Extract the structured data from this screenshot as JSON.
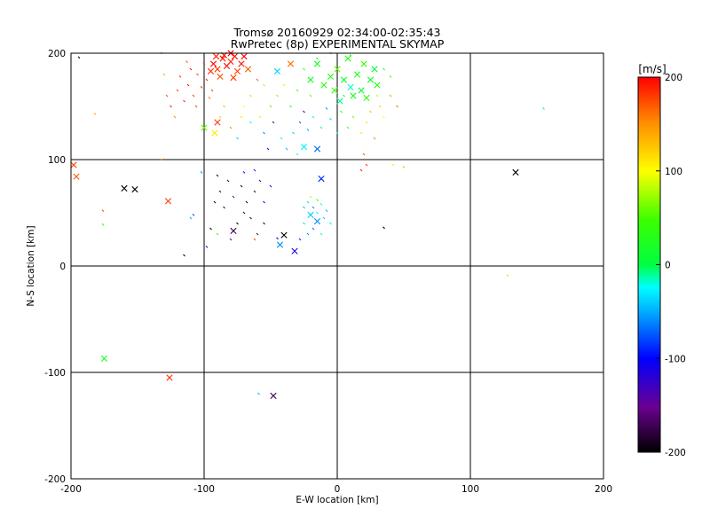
{
  "chart_data": {
    "type": "scatter",
    "title": "Tromsø 20160929 02:34:00-02:35:43",
    "subtitle": "RwPretec (8p) EXPERIMENTAL SKYMAP",
    "xlabel": "E-W location [km]",
    "ylabel": "N-S location [km]",
    "xlim": [
      -200,
      200
    ],
    "ylim": [
      -200,
      200
    ],
    "xticks": [
      "-200",
      "-100",
      "0",
      "100",
      "200"
    ],
    "yticks": [
      "-200",
      "-100",
      "0",
      "100",
      "200"
    ],
    "grid": true,
    "colorbar": {
      "label": "[m/s]",
      "range": [
        -200,
        200
      ],
      "ticks": [
        "-200",
        "-100",
        "0",
        "100",
        "200"
      ]
    },
    "cross_points": [
      {
        "x": -93,
        "y": 190,
        "v": 195
      },
      {
        "x": -90,
        "y": 185,
        "v": 180
      },
      {
        "x": -86,
        "y": 195,
        "v": 190
      },
      {
        "x": -83,
        "y": 188,
        "v": 200
      },
      {
        "x": -80,
        "y": 192,
        "v": 185
      },
      {
        "x": -77,
        "y": 197,
        "v": 195
      },
      {
        "x": -75,
        "y": 183,
        "v": 175
      },
      {
        "x": -72,
        "y": 190,
        "v": 190
      },
      {
        "x": -70,
        "y": 197,
        "v": 200
      },
      {
        "x": -88,
        "y": 178,
        "v": 170
      },
      {
        "x": -95,
        "y": 183,
        "v": 185
      },
      {
        "x": -85,
        "y": 198,
        "v": 195
      },
      {
        "x": -67,
        "y": 185,
        "v": 165
      },
      {
        "x": -78,
        "y": 177,
        "v": 180
      },
      {
        "x": -91,
        "y": 197,
        "v": 190
      },
      {
        "x": -80,
        "y": 200,
        "v": 200
      },
      {
        "x": -35,
        "y": 190,
        "v": 160
      },
      {
        "x": -15,
        "y": 190,
        "v": 20
      },
      {
        "x": -45,
        "y": 183,
        "v": -40
      },
      {
        "x": -10,
        "y": 170,
        "v": 40
      },
      {
        "x": -5,
        "y": 178,
        "v": 30
      },
      {
        "x": 0,
        "y": 185,
        "v": 60
      },
      {
        "x": 5,
        "y": 175,
        "v": 10
      },
      {
        "x": 10,
        "y": 168,
        "v": -20
      },
      {
        "x": 15,
        "y": 180,
        "v": 25
      },
      {
        "x": 20,
        "y": 190,
        "v": 45
      },
      {
        "x": 25,
        "y": 175,
        "v": 15
      },
      {
        "x": 30,
        "y": 170,
        "v": 30
      },
      {
        "x": 12,
        "y": 160,
        "v": 20
      },
      {
        "x": -2,
        "y": 165,
        "v": 50
      },
      {
        "x": 8,
        "y": 195,
        "v": 35
      },
      {
        "x": 18,
        "y": 165,
        "v": 5
      },
      {
        "x": -20,
        "y": 175,
        "v": 15
      },
      {
        "x": 2,
        "y": 155,
        "v": -10
      },
      {
        "x": 22,
        "y": 158,
        "v": 40
      },
      {
        "x": 28,
        "y": 185,
        "v": 0
      },
      {
        "x": -90,
        "y": 135,
        "v": 175
      },
      {
        "x": -92,
        "y": 125,
        "v": 110
      },
      {
        "x": -100,
        "y": 130,
        "v": 60
      },
      {
        "x": -15,
        "y": 110,
        "v": -70
      },
      {
        "x": -25,
        "y": 112,
        "v": -30
      },
      {
        "x": -12,
        "y": 82,
        "v": -90
      },
      {
        "x": -198,
        "y": 95,
        "v": 175
      },
      {
        "x": -196,
        "y": 84,
        "v": 170
      },
      {
        "x": -160,
        "y": 73,
        "v": -200
      },
      {
        "x": -152,
        "y": 72,
        "v": -200
      },
      {
        "x": -127,
        "y": 61,
        "v": 180
      },
      {
        "x": -78,
        "y": 33,
        "v": -170
      },
      {
        "x": -40,
        "y": 29,
        "v": -200
      },
      {
        "x": -32,
        "y": 14,
        "v": -110
      },
      {
        "x": -43,
        "y": 20,
        "v": -60
      },
      {
        "x": -20,
        "y": 48,
        "v": -40
      },
      {
        "x": -15,
        "y": 42,
        "v": -60
      },
      {
        "x": 134,
        "y": 88,
        "v": -200
      },
      {
        "x": -175,
        "y": -87,
        "v": 20
      },
      {
        "x": -126,
        "y": -105,
        "v": 180
      },
      {
        "x": -48,
        "y": -122,
        "v": -170
      }
    ],
    "dot_points": [
      {
        "x": -98,
        "y": 175,
        "v": 190
      },
      {
        "x": -102,
        "y": 168,
        "v": 185
      },
      {
        "x": -105,
        "y": 180,
        "v": 175
      },
      {
        "x": -108,
        "y": 160,
        "v": 180
      },
      {
        "x": -112,
        "y": 170,
        "v": 195
      },
      {
        "x": -115,
        "y": 155,
        "v": 185
      },
      {
        "x": -120,
        "y": 165,
        "v": 175
      },
      {
        "x": -125,
        "y": 150,
        "v": 190
      },
      {
        "x": -128,
        "y": 160,
        "v": 170
      },
      {
        "x": -110,
        "y": 185,
        "v": 195
      },
      {
        "x": -100,
        "y": 190,
        "v": 185
      },
      {
        "x": -96,
        "y": 158,
        "v": 160
      },
      {
        "x": -94,
        "y": 165,
        "v": 175
      },
      {
        "x": -118,
        "y": 178,
        "v": 180
      },
      {
        "x": -130,
        "y": 180,
        "v": 60
      },
      {
        "x": -132,
        "y": 200,
        "v": 40
      },
      {
        "x": -113,
        "y": 192,
        "v": 170
      },
      {
        "x": -122,
        "y": 140,
        "v": 150
      },
      {
        "x": -106,
        "y": 150,
        "v": 175
      },
      {
        "x": -182,
        "y": 143,
        "v": 140
      },
      {
        "x": -194,
        "y": 196,
        "v": -180
      },
      {
        "x": -60,
        "y": 175,
        "v": 170
      },
      {
        "x": -65,
        "y": 160,
        "v": 120
      },
      {
        "x": -70,
        "y": 150,
        "v": 100
      },
      {
        "x": -55,
        "y": 170,
        "v": 80
      },
      {
        "x": -50,
        "y": 150,
        "v": 60
      },
      {
        "x": -58,
        "y": 140,
        "v": 90
      },
      {
        "x": -72,
        "y": 140,
        "v": 110
      },
      {
        "x": -85,
        "y": 150,
        "v": 130
      },
      {
        "x": -88,
        "y": 140,
        "v": 120
      },
      {
        "x": -80,
        "y": 130,
        "v": 150
      },
      {
        "x": -75,
        "y": 120,
        "v": -40
      },
      {
        "x": -65,
        "y": 135,
        "v": -20
      },
      {
        "x": -55,
        "y": 125,
        "v": -60
      },
      {
        "x": -52,
        "y": 110,
        "v": -100
      },
      {
        "x": -48,
        "y": 135,
        "v": -150
      },
      {
        "x": -42,
        "y": 120,
        "v": -30
      },
      {
        "x": -38,
        "y": 110,
        "v": -50
      },
      {
        "x": -33,
        "y": 125,
        "v": -40
      },
      {
        "x": -30,
        "y": 105,
        "v": -20
      },
      {
        "x": -28,
        "y": 135,
        "v": -70
      },
      {
        "x": -25,
        "y": 145,
        "v": -160
      },
      {
        "x": -22,
        "y": 128,
        "v": -50
      },
      {
        "x": -18,
        "y": 140,
        "v": -30
      },
      {
        "x": -12,
        "y": 130,
        "v": -10
      },
      {
        "x": -8,
        "y": 148,
        "v": -60
      },
      {
        "x": -5,
        "y": 138,
        "v": -40
      },
      {
        "x": 0,
        "y": 125,
        "v": -20
      },
      {
        "x": 3,
        "y": 145,
        "v": 10
      },
      {
        "x": 8,
        "y": 130,
        "v": 40
      },
      {
        "x": 12,
        "y": 140,
        "v": 60
      },
      {
        "x": 18,
        "y": 125,
        "v": 90
      },
      {
        "x": 22,
        "y": 135,
        "v": 110
      },
      {
        "x": 25,
        "y": 145,
        "v": 130
      },
      {
        "x": 28,
        "y": 120,
        "v": 150
      },
      {
        "x": 32,
        "y": 150,
        "v": 120
      },
      {
        "x": 35,
        "y": 140,
        "v": 100
      },
      {
        "x": 40,
        "y": 160,
        "v": 140
      },
      {
        "x": 45,
        "y": 150,
        "v": 160
      },
      {
        "x": 30,
        "y": 160,
        "v": 80
      },
      {
        "x": 20,
        "y": 105,
        "v": 170
      },
      {
        "x": 22,
        "y": 95,
        "v": 180
      },
      {
        "x": 18,
        "y": 90,
        "v": 190
      },
      {
        "x": 42,
        "y": 95,
        "v": 110
      },
      {
        "x": 50,
        "y": 93,
        "v": 60
      },
      {
        "x": 40,
        "y": 178,
        "v": 50
      },
      {
        "x": 35,
        "y": 185,
        "v": 20
      },
      {
        "x": -5,
        "y": 200,
        "v": 40
      },
      {
        "x": 10,
        "y": 198,
        "v": 20
      },
      {
        "x": -15,
        "y": 195,
        "v": 0
      },
      {
        "x": -25,
        "y": 185,
        "v": 30
      },
      {
        "x": -30,
        "y": 165,
        "v": 50
      },
      {
        "x": -40,
        "y": 170,
        "v": 90
      },
      {
        "x": -45,
        "y": 160,
        "v": 70
      },
      {
        "x": -35,
        "y": 150,
        "v": 20
      },
      {
        "x": -20,
        "y": 160,
        "v": 60
      },
      {
        "x": 5,
        "y": 160,
        "v": 0
      },
      {
        "x": 155,
        "y": 148,
        "v": -10
      },
      {
        "x": -90,
        "y": 85,
        "v": -190
      },
      {
        "x": -82,
        "y": 80,
        "v": -180
      },
      {
        "x": -88,
        "y": 70,
        "v": -170
      },
      {
        "x": -78,
        "y": 65,
        "v": -150
      },
      {
        "x": -72,
        "y": 75,
        "v": -190
      },
      {
        "x": -68,
        "y": 60,
        "v": -200
      },
      {
        "x": -62,
        "y": 70,
        "v": -170
      },
      {
        "x": -58,
        "y": 80,
        "v": -160
      },
      {
        "x": -70,
        "y": 50,
        "v": -180
      },
      {
        "x": -85,
        "y": 55,
        "v": -170
      },
      {
        "x": -92,
        "y": 60,
        "v": -190
      },
      {
        "x": -75,
        "y": 40,
        "v": -200
      },
      {
        "x": -65,
        "y": 45,
        "v": -180
      },
      {
        "x": -55,
        "y": 40,
        "v": -190
      },
      {
        "x": -60,
        "y": 30,
        "v": -160
      },
      {
        "x": -80,
        "y": 25,
        "v": -150
      },
      {
        "x": -95,
        "y": 35,
        "v": -200
      },
      {
        "x": -98,
        "y": 18,
        "v": -130
      },
      {
        "x": -90,
        "y": 30,
        "v": 40
      },
      {
        "x": -55,
        "y": 60,
        "v": -100
      },
      {
        "x": -50,
        "y": 75,
        "v": -110
      },
      {
        "x": -62,
        "y": 90,
        "v": -90
      },
      {
        "x": -70,
        "y": 88,
        "v": -120
      },
      {
        "x": -102,
        "y": 88,
        "v": -60
      },
      {
        "x": -108,
        "y": 48,
        "v": -80
      },
      {
        "x": -110,
        "y": 45,
        "v": -50
      },
      {
        "x": -115,
        "y": 10,
        "v": -200
      },
      {
        "x": -176,
        "y": 52,
        "v": 170
      },
      {
        "x": -176,
        "y": 39,
        "v": 30
      },
      {
        "x": -132,
        "y": 100,
        "v": 150
      },
      {
        "x": -25,
        "y": 55,
        "v": -50
      },
      {
        "x": -22,
        "y": 60,
        "v": -40
      },
      {
        "x": -18,
        "y": 55,
        "v": -60
      },
      {
        "x": -15,
        "y": 50,
        "v": -30
      },
      {
        "x": -12,
        "y": 58,
        "v": -20
      },
      {
        "x": -10,
        "y": 45,
        "v": -40
      },
      {
        "x": -8,
        "y": 52,
        "v": -50
      },
      {
        "x": -5,
        "y": 40,
        "v": -30
      },
      {
        "x": -18,
        "y": 35,
        "v": -70
      },
      {
        "x": -22,
        "y": 30,
        "v": -60
      },
      {
        "x": -25,
        "y": 40,
        "v": -40
      },
      {
        "x": -28,
        "y": 25,
        "v": -90
      },
      {
        "x": -12,
        "y": 30,
        "v": -20
      },
      {
        "x": -15,
        "y": 62,
        "v": 50
      },
      {
        "x": -20,
        "y": 65,
        "v": 80
      },
      {
        "x": 35,
        "y": 36,
        "v": -200
      },
      {
        "x": 128,
        "y": -9,
        "v": 120
      },
      {
        "x": -59,
        "y": -120,
        "v": -50
      },
      {
        "x": -62,
        "y": 25,
        "v": 170
      },
      {
        "x": -45,
        "y": 26,
        "v": -120
      }
    ]
  }
}
